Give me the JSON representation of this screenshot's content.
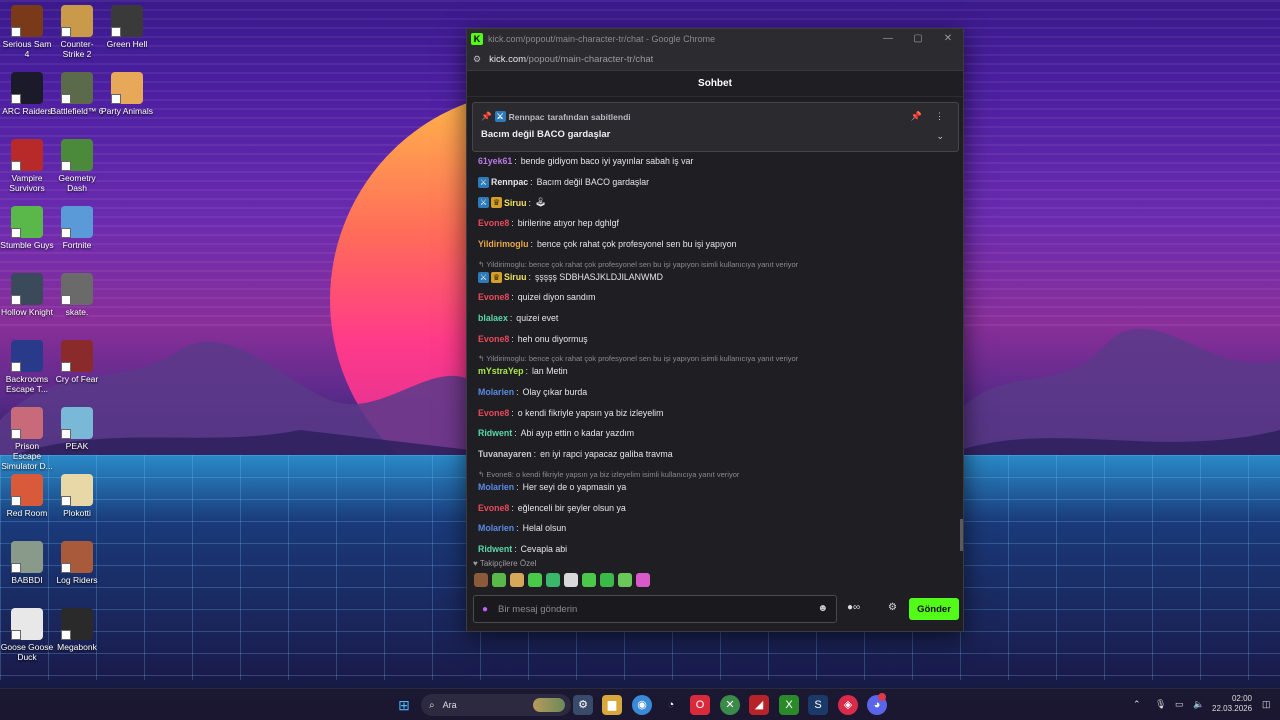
{
  "desktop": {
    "icons": [
      {
        "label": "Serious Sam 4",
        "color": "#7a3a1a"
      },
      {
        "label": "Counter-Strike 2",
        "color": "#c89a4a"
      },
      {
        "label": "Green Hell",
        "color": "#3a3a3a"
      },
      {
        "label": "ARC Raiders",
        "color": "#1a1a2a"
      },
      {
        "label": "Battlefield™ 6",
        "color": "#5a6a4a"
      },
      {
        "label": "Party Animals",
        "color": "#e8a85a"
      },
      {
        "label": "Vampire Survivors",
        "color": "#b82a2a"
      },
      {
        "label": "Geometry Dash",
        "color": "#4a8a3a"
      },
      {
        "label": "Stumble Guys",
        "color": "#5ab84a"
      },
      {
        "label": "Fortnite",
        "color": "#5a9ad8"
      },
      {
        "label": "Hollow Knight",
        "color": "#3a4a5a"
      },
      {
        "label": "skate.",
        "color": "#6a6a6a"
      },
      {
        "label": "Backrooms Escape T...",
        "color": "#2a3a8a"
      },
      {
        "label": "Cry of Fear",
        "color": "#8a2a2a"
      },
      {
        "label": "Prison Escape Simulator D...",
        "color": "#c86a7a"
      },
      {
        "label": "PEAK",
        "color": "#7ab8d8"
      },
      {
        "label": "Red Room",
        "color": "#d85a3a"
      },
      {
        "label": "Plokotti",
        "color": "#e8d8a8"
      },
      {
        "label": "BABBDI",
        "color": "#8a9a8a"
      },
      {
        "label": "Log Riders",
        "color": "#a85a3a"
      },
      {
        "label": "Goose Goose Duck",
        "color": "#e8e8e8"
      },
      {
        "label": "Megabonk",
        "color": "#2a2a2a"
      }
    ]
  },
  "window": {
    "title": "kick.com/popout/main-character-tr/chat - Google Chrome",
    "url_host": "kick.com",
    "url_path": "/popout/main-character-tr/chat",
    "minimize": "—",
    "maximize": "▢",
    "close": "✕"
  },
  "chat": {
    "header": "Sohbet",
    "pinned": {
      "by_user": "Rennpac",
      "by_suffix": "tarafından sabitlendi",
      "message": "Bacım değil BACO gardaşlar"
    },
    "messages": [
      {
        "type": "msg",
        "user": "61yek61",
        "color": "#b87ae8",
        "text": "bende gidiyom baco iyi yayınlar sabah iş var",
        "badges": []
      },
      {
        "type": "msg",
        "user": "Rennpac",
        "color": "#e6e6ea",
        "text": "Bacım değil BACO gardaşlar",
        "badges": [
          "mod"
        ]
      },
      {
        "type": "msg",
        "user": "Siruu",
        "color": "#f0e060",
        "text": "🕹",
        "badges": [
          "mod",
          "crown"
        ]
      },
      {
        "type": "msg",
        "user": "Evone8",
        "color": "#e84a5a",
        "text": "birilerine atıyor hep dghlgf",
        "badges": []
      },
      {
        "type": "msg",
        "user": "Yildirimoglu",
        "color": "#e8a84a",
        "text": "bence çok rahat çok profesyonel sen bu işi yapıyon",
        "badges": []
      },
      {
        "type": "reply",
        "text": "↰ Yildirimoglu: bence çok rahat çok profesyonel sen bu işi yapıyon isimli kullanıcıya yanıt veriyor"
      },
      {
        "type": "msg",
        "user": "Siruu",
        "color": "#f0e060",
        "text": "şşşşş SDBHASJKLDJILANWMD",
        "badges": [
          "mod",
          "crown"
        ]
      },
      {
        "type": "msg",
        "user": "Evone8",
        "color": "#e84a5a",
        "text": "quizei diyon sandım",
        "badges": []
      },
      {
        "type": "msg",
        "user": "blalaex",
        "color": "#5ad8a8",
        "text": "quizei evet",
        "badges": []
      },
      {
        "type": "msg",
        "user": "Evone8",
        "color": "#e84a5a",
        "text": "heh onu diyormuş",
        "badges": []
      },
      {
        "type": "reply",
        "text": "↰ Yildirimoglu: bence çok rahat çok profesyonel sen bu işi yapıyon isimli kullanıcıya yanıt veriyor"
      },
      {
        "type": "msg",
        "user": "mYstraYep",
        "color": "#a8e84a",
        "text": "lan Metin",
        "badges": []
      },
      {
        "type": "msg",
        "user": "Molarien",
        "color": "#5a8ae8",
        "text": "Olay çıkar burda",
        "badges": []
      },
      {
        "type": "msg",
        "user": "Evone8",
        "color": "#e84a5a",
        "text": "o kendi fikriyle yapsın ya biz izleyelim",
        "badges": []
      },
      {
        "type": "msg",
        "user": "Ridwent",
        "color": "#5ad8a8",
        "text": "Abi ayıp ettin o kadar yazdım",
        "badges": []
      },
      {
        "type": "msg",
        "user": "Tuvanayaren",
        "color": "#c8c8cc",
        "text": "en iyi rapci yapacaz galiba travma",
        "badges": []
      },
      {
        "type": "reply",
        "text": "↰ Evone8: o kendi fikriyle yapsın ya biz izleyelim isimli kullanıcıya yanıt veriyor"
      },
      {
        "type": "msg",
        "user": "Molarien",
        "color": "#5a8ae8",
        "text": "Her seyi de o yapmasin ya",
        "badges": []
      },
      {
        "type": "msg",
        "user": "Evone8",
        "color": "#e84a5a",
        "text": "eğlenceli bir şeyler olsun ya",
        "badges": []
      },
      {
        "type": "msg",
        "user": "Molarien",
        "color": "#5a8ae8",
        "text": "Helal olsun",
        "badges": []
      },
      {
        "type": "msg",
        "user": "Ridwent",
        "color": "#5ad8a8",
        "text": "Cevapla abi",
        "badges": []
      }
    ],
    "followers_label": "♥ Takipçilere Özel",
    "emotes": [
      "#8a5a3a",
      "#5ab84a",
      "#d8a85a",
      "#4ac84a",
      "#3ab86a",
      "#d8d8d8",
      "#4ac84a",
      "#3ab84a",
      "#6ac85a",
      "#d85ac8"
    ],
    "input_placeholder": "Bir mesaj gönderin",
    "send_label": "Gönder"
  },
  "taskbar": {
    "search_label": "Ara",
    "time": "02:00",
    "date": "22.03.2026"
  },
  "colors": {
    "kick_green": "#53fc18"
  }
}
